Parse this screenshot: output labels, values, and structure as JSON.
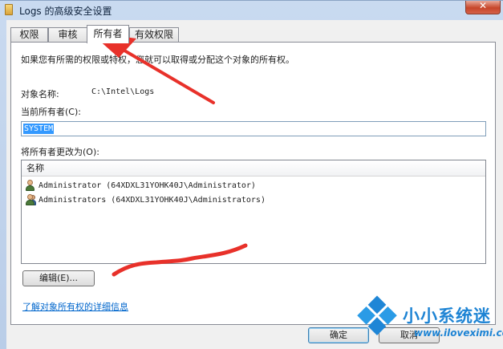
{
  "window": {
    "title": "Logs 的高级安全设置",
    "close_glyph": "✕"
  },
  "tabs": [
    {
      "label": "权限",
      "active": false
    },
    {
      "label": "审核",
      "active": false
    },
    {
      "label": "所有者",
      "active": true
    },
    {
      "label": "有效权限",
      "active": false
    }
  ],
  "owner_panel": {
    "description": "如果您有所需的权限或特权，您就可以取得或分配这个对象的所有权。",
    "object_name_label": "对象名称:",
    "object_name_value": "C:\\Intel\\Logs",
    "current_owner_label": "当前所有者(C):",
    "current_owner_value": "SYSTEM",
    "change_owner_label": "将所有者更改为(O):",
    "list_header": "名称",
    "owners": [
      {
        "name": "Administrator (64XDXL31YOHK40J\\Administrator)",
        "icon": "user-icon"
      },
      {
        "name": "Administrators (64XDXL31YOHK40J\\Administrators)",
        "icon": "group-icon"
      }
    ],
    "edit_button": "编辑(E)...",
    "learn_more_link": "了解对象所有权的详细信息"
  },
  "footer": {
    "ok_label": "确定",
    "cancel_label": "取消"
  },
  "watermark": {
    "title": "小小系统迷",
    "url": "www.iloveximi.com"
  },
  "colors": {
    "annotation": "#e8312a",
    "selection": "#3399ff",
    "link": "#0066cc",
    "watermark": "#1e84d4"
  }
}
